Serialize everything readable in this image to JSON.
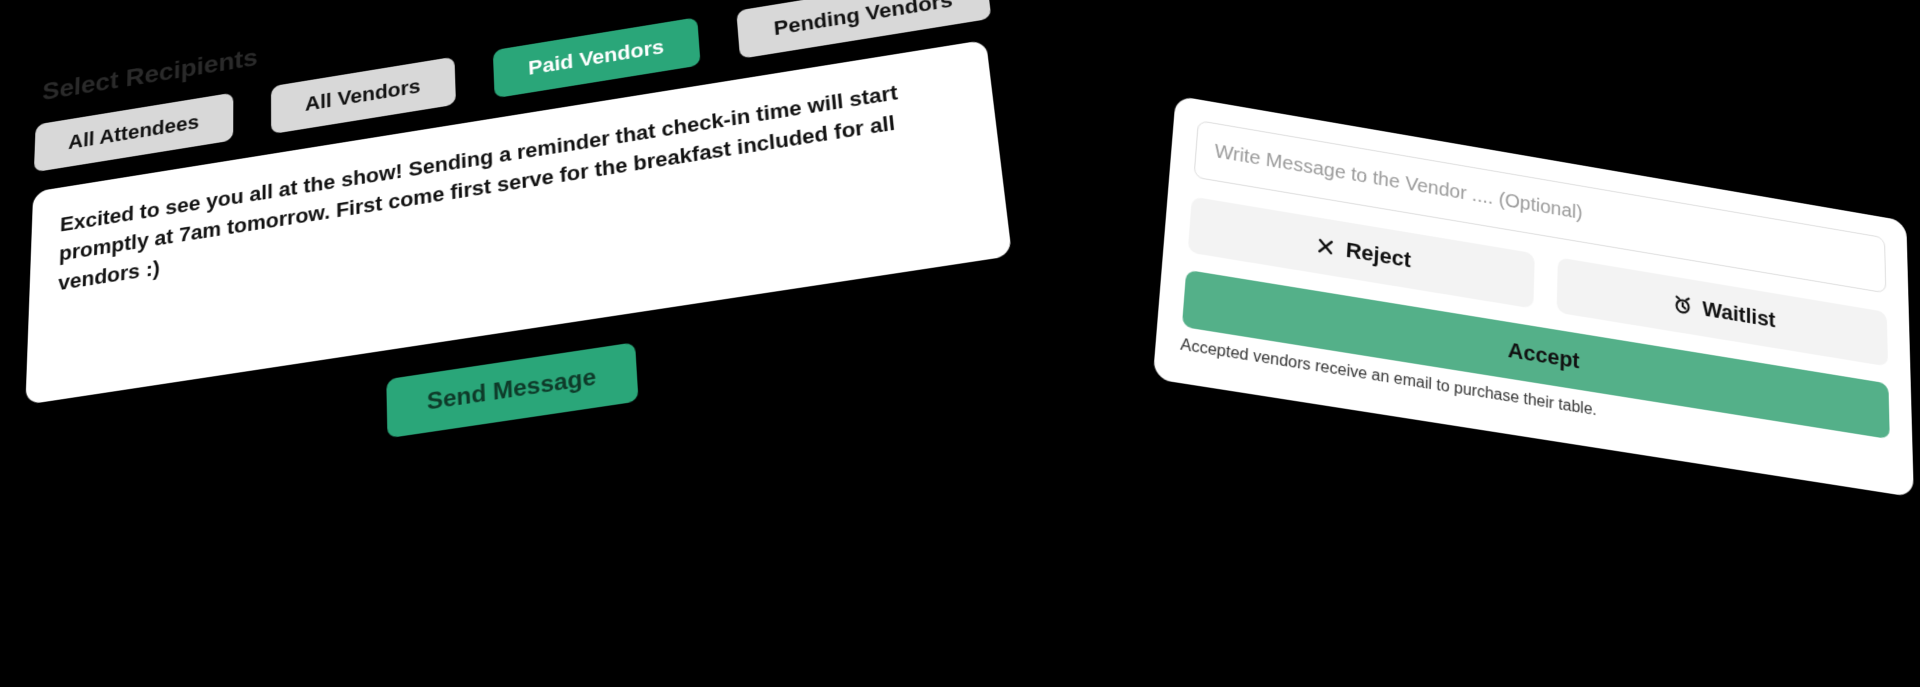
{
  "left": {
    "heading": "Select Recipients",
    "chips": [
      {
        "label": "All Attendees",
        "active": false
      },
      {
        "label": "All Vendors",
        "active": false
      },
      {
        "label": "Paid Vendors",
        "active": true
      },
      {
        "label": "Pending Vendors",
        "active": false
      }
    ],
    "message": "Excited to see you all at the show! Sending a reminder that check-in time will start promptly at 7am tomorrow. First come first serve for the breakfast included for all vendors :)",
    "send_label": "Send Message"
  },
  "right": {
    "placeholder": "Write Message to the Vendor .... (Optional)",
    "reject_label": "Reject",
    "waitlist_label": "Waitlist",
    "accept_label": "Accept",
    "helper": "Accepted vendors receive an email to purchase their table."
  },
  "colors": {
    "accent": "#2aa679",
    "accent_soft": "#54b089",
    "chip_bg": "#d8d8d8"
  }
}
